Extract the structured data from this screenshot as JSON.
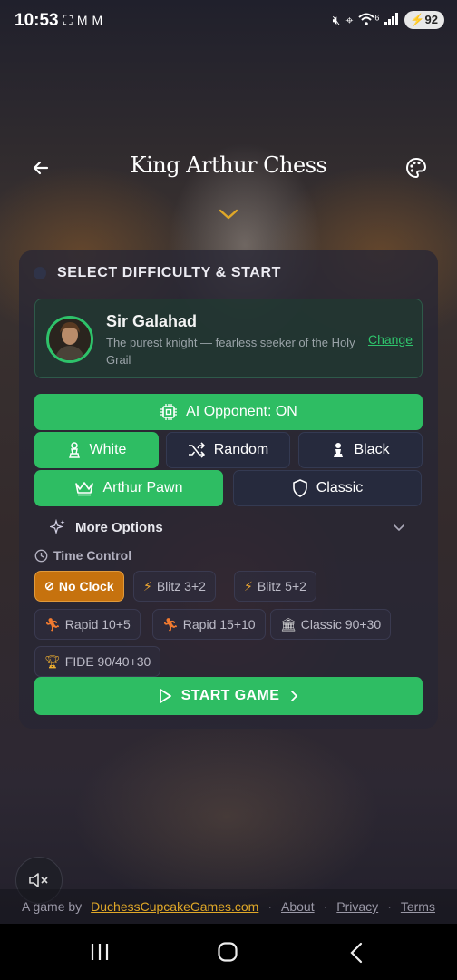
{
  "status_bar": {
    "time": "10:53",
    "notification_icons": [
      "screenshot-icon",
      "gmail-icon",
      "gmail-icon"
    ],
    "signal_label": "6",
    "battery": "92"
  },
  "header": {
    "title": "King Arthur Chess",
    "icons": {
      "back": "arrow-left-icon",
      "palette": "palette-icon",
      "expand": "chevron-down-icon"
    }
  },
  "difficulty": {
    "section_title": "SELECT DIFFICULTY & START",
    "opponent": {
      "name": "Sir Galahad",
      "description": "The purest knight — fearless seeker of the Holy Grail",
      "change_label": "Change"
    },
    "ai_toggle_label": "AI Opponent: ON",
    "colors": [
      {
        "label": "White",
        "selected": true
      },
      {
        "label": "Random",
        "selected": false
      },
      {
        "label": "Black",
        "selected": false
      }
    ],
    "variants": [
      {
        "label": "Arthur Pawn",
        "selected": true
      },
      {
        "label": "Classic",
        "selected": false
      }
    ],
    "more_options_label": "More Options",
    "time_control": {
      "label": "Time Control",
      "options": [
        {
          "label": "No Clock",
          "selected": true,
          "icon": "no-clock-icon"
        },
        {
          "label": "Blitz 3+2",
          "selected": false,
          "icon": "lightning-icon"
        },
        {
          "label": "Blitz 5+2",
          "selected": false,
          "icon": "lightning-icon"
        },
        {
          "label": "Rapid 10+5",
          "selected": false,
          "icon": "runner-icon"
        },
        {
          "label": "Rapid 15+10",
          "selected": false,
          "icon": "runner-icon"
        },
        {
          "label": "Classic 90+30",
          "selected": false,
          "icon": "classical-building-icon"
        },
        {
          "label": "FIDE 90/40+30",
          "selected": false,
          "icon": "trophy-icon"
        }
      ]
    },
    "start_label": "START GAME"
  },
  "footer": {
    "prefix": "A game by",
    "brand": "DuchessCupcakeGames.com",
    "links": [
      "About",
      "Privacy",
      "Terms"
    ],
    "separator": "·"
  },
  "colors": {
    "accent_green": "#2ebd63",
    "accent_orange": "#c6720e",
    "link_gold": "#e0a828"
  }
}
